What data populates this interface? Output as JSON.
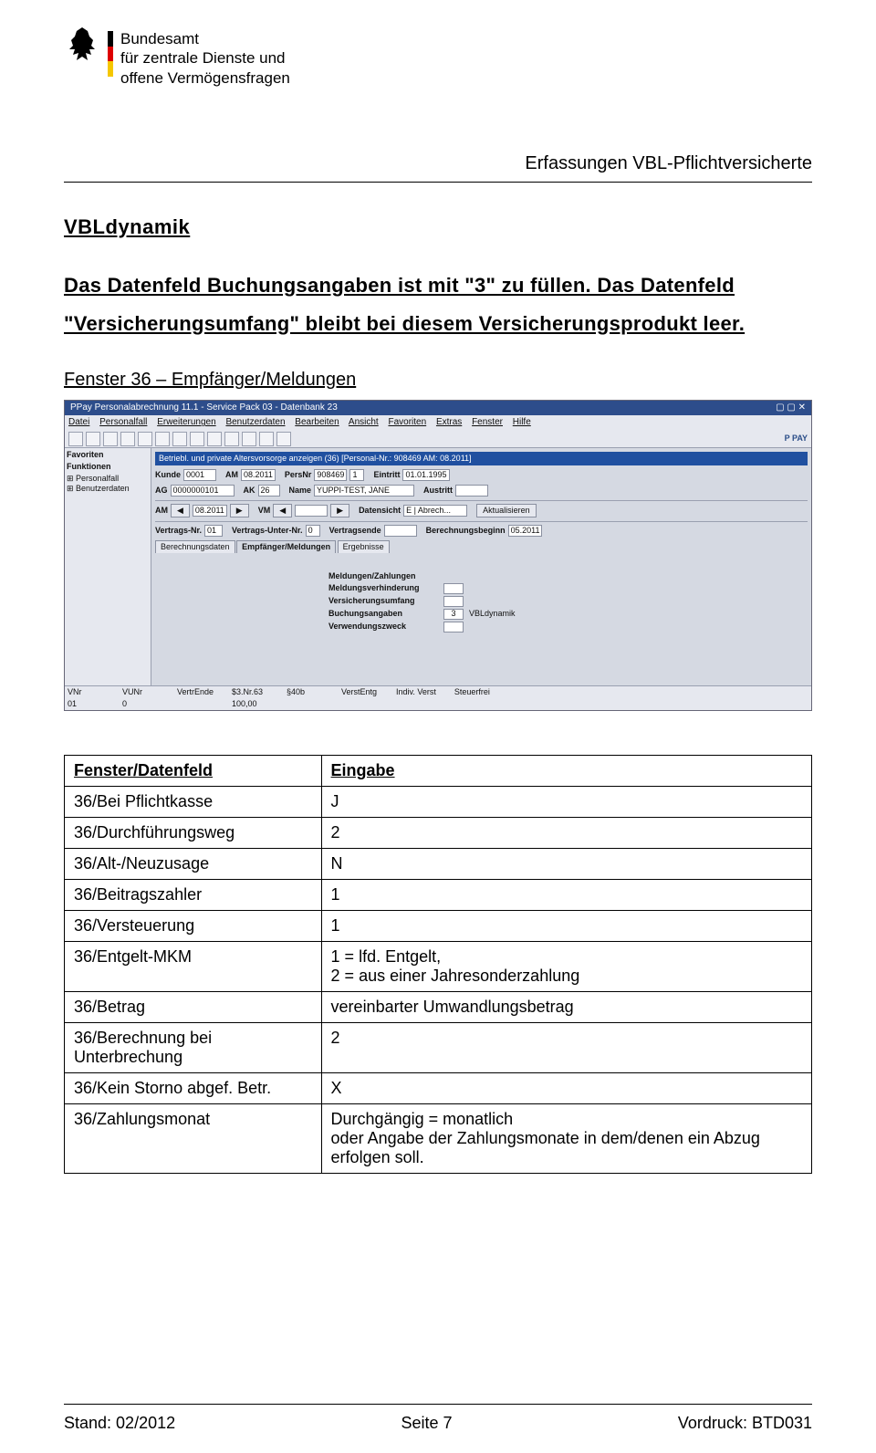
{
  "header": {
    "org_line1": "Bundesamt",
    "org_line2": "für zentrale Dienste und",
    "org_line3": "offene Vermögensfragen",
    "doc_title": "Erfassungen VBL-Pflichtversicherte"
  },
  "section": {
    "heading": "VBLdynamik",
    "para": "Das Datenfeld Buchungsangaben ist mit \"3\" zu füllen. Das Datenfeld \"Versicherungsumfang\" bleibt bei diesem Versicherungsprodukt leer.",
    "subheading": "Fenster 36 – Empfänger/Meldungen"
  },
  "app": {
    "title": "PPay Personalabrechnung 11.1 - Service Pack 03 - Datenbank 23",
    "menu": [
      "Datei",
      "Personalfall",
      "Erweiterungen",
      "Benutzerdaten",
      "Bearbeiten",
      "Ansicht",
      "Favoriten",
      "Extras",
      "Fenster",
      "Hilfe"
    ],
    "pay_label": "P PAY",
    "leftnav": {
      "favoriten": "Favoriten",
      "funktionen": "Funktionen",
      "items": [
        "Personalfall",
        "Benutzerdaten"
      ]
    },
    "bluebar": "Betriebl. und private Altersvorsorge anzeigen (36) [Personal-Nr.: 908469 AM: 08.2011]",
    "row1": {
      "kunde_l": "Kunde",
      "kunde_v": "0001",
      "ag_l": "AG",
      "ag_v": "0000000101",
      "am_l": "AM",
      "am_v": "08.2011",
      "ak_l": "AK",
      "ak_v": "26",
      "persnr_l": "PersNr",
      "persnr_v": "908469",
      "persnr_s": "1",
      "name_l": "Name",
      "name_v": "YUPPI-TEST, JANE",
      "eintritt_l": "Eintritt",
      "eintritt_v": "01.01.1995",
      "austritt_l": "Austritt"
    },
    "row2": {
      "am_l": "AM",
      "am_v": "08.2011",
      "vm_l": "VM",
      "ds_l": "Datensicht",
      "ds_v": "E | Abrech...",
      "akt": "Aktualisieren"
    },
    "row3": {
      "vnr_l": "Vertrags-Nr.",
      "vnr_v": "01",
      "vunr_l": "Vertrags-Unter-Nr.",
      "vunr_v": "0",
      "vende_l": "Vertragsende",
      "bbeg_l": "Berechnungsbeginn",
      "bbeg_v": "05.2011"
    },
    "tabs": [
      "Berechnungsdaten",
      "Empfänger/Meldungen",
      "Ergebnisse"
    ],
    "center": {
      "meldungen_zahlungen": "Meldungen/Zahlungen",
      "meldungsverhinderung": "Meldungsverhinderung",
      "versicherungsumfang": "Versicherungsumfang",
      "buchungsangaben": "Buchungsangaben",
      "buchungsangaben_v": "3",
      "buchungsangaben_r": "VBLdynamik",
      "verwendungszweck": "Verwendungszweck"
    },
    "status_hdr": [
      "VNr",
      "VUNr",
      "VertrEnde",
      "$3.Nr.63",
      "§40b",
      "VerstEntg",
      "Indiv. Verst",
      "Steuerfrei"
    ],
    "status_val": [
      "01",
      "0",
      "",
      "100,00",
      "",
      "",
      "",
      ""
    ]
  },
  "table": {
    "header_left": "Fenster/Datenfeld",
    "header_right": "Eingabe",
    "rows": [
      {
        "l": "36/Bei Pflichtkasse",
        "r": "J"
      },
      {
        "l": "36/Durchführungsweg",
        "r": "2"
      },
      {
        "l": "36/Alt-/Neuzusage",
        "r": "N"
      },
      {
        "l": "36/Beitragszahler",
        "r": "1"
      },
      {
        "l": "36/Versteuerung",
        "r": "1"
      },
      {
        "l": "36/Entgelt-MKM",
        "r": "1 = lfd. Entgelt,\n2 = aus einer Jahresonderzahlung"
      },
      {
        "l": "36/Betrag",
        "r": "vereinbarter Umwandlungsbetrag"
      },
      {
        "l": "36/Berechnung bei Unterbrechung",
        "r": "2"
      },
      {
        "l": "36/Kein Storno abgef. Betr.",
        "r": "X"
      },
      {
        "l": "36/Zahlungsmonat",
        "r": "Durchgängig = monatlich\noder Angabe der Zahlungsmonate in dem/denen ein Abzug erfolgen soll."
      }
    ]
  },
  "footer": {
    "left": "Stand: 02/2012",
    "center": "Seite 7",
    "right": "Vordruck: BTD031"
  }
}
